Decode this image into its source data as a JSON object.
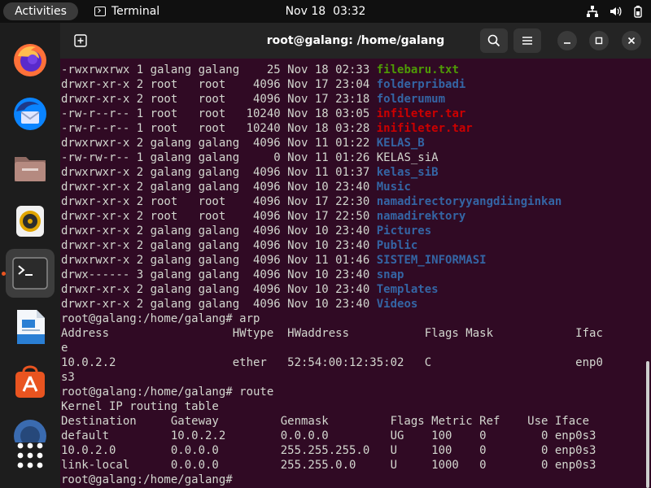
{
  "topbar": {
    "activities": "Activities",
    "app_name": "Terminal",
    "clock_date": "Nov 18",
    "clock_time": "03:32",
    "tray_icons": [
      "network-icon",
      "volume-icon",
      "battery-icon"
    ]
  },
  "dock": {
    "items": [
      {
        "name": "firefox",
        "icon": "firefox-icon",
        "running": false
      },
      {
        "name": "thunderbird",
        "icon": "thunderbird-icon",
        "running": false
      },
      {
        "name": "files",
        "icon": "folder-icon",
        "running": false
      },
      {
        "name": "rhythmbox",
        "icon": "speaker-icon",
        "running": false
      },
      {
        "name": "terminal",
        "icon": "terminal-icon",
        "running": true
      },
      {
        "name": "libreoffice-writer",
        "icon": "writer-icon",
        "running": false
      },
      {
        "name": "app-center",
        "icon": "store-icon",
        "running": false
      },
      {
        "name": "help",
        "icon": "help-icon",
        "running": false
      },
      {
        "name": "show-apps",
        "icon": "apps-grid-icon",
        "running": false
      }
    ]
  },
  "window": {
    "title": "root@galang: /home/galang",
    "buttons": [
      "new-tab-icon",
      "search-icon",
      "menu-icon",
      "minimize-icon",
      "maximize-icon",
      "close-icon"
    ]
  },
  "colors": {
    "terminal_bg": "#300a24",
    "text": "#d3d7cf",
    "executable": "#4e9a06",
    "directory": "#3465a4",
    "archive": "#cc0000",
    "accent": "#e95420"
  },
  "terminal": {
    "lines": [
      {
        "text": "-rwxrwxrwx 1 galang galang    25 Nov 18 02:33 ",
        "name": "filebaru.txt",
        "kind": "exec"
      },
      {
        "text": "drwxr-xr-x 2 root   root    4096 Nov 17 23:04 ",
        "name": "folderpribadi",
        "kind": "dir"
      },
      {
        "text": "drwxr-xr-x 2 root   root    4096 Nov 17 23:18 ",
        "name": "folderumum",
        "kind": "dir"
      },
      {
        "text": "-rw-r--r-- 1 root   root   10240 Nov 18 03:05 ",
        "name": "infileter.tar",
        "kind": "arch"
      },
      {
        "text": "-rw-r--r-- 1 root   root   10240 Nov 18 03:28 ",
        "name": "inifileter.tar",
        "kind": "arch"
      },
      {
        "text": "drwxrwxr-x 2 galang galang  4096 Nov 11 01:22 ",
        "name": "KELAS_B",
        "kind": "dir"
      },
      {
        "text": "-rw-rw-r-- 1 galang galang     0 Nov 11 01:26 ",
        "name": "KELAS_siA",
        "kind": "plain"
      },
      {
        "text": "drwxrwxr-x 2 galang galang  4096 Nov 11 01:37 ",
        "name": "kelas_siB",
        "kind": "dir"
      },
      {
        "text": "drwxr-xr-x 2 galang galang  4096 Nov 10 23:40 ",
        "name": "Music",
        "kind": "dir"
      },
      {
        "text": "drwxr-xr-x 2 root   root    4096 Nov 17 22:30 ",
        "name": "namadirectoryyangdiinginkan",
        "kind": "dir"
      },
      {
        "text": "drwxr-xr-x 2 root   root    4096 Nov 17 22:50 ",
        "name": "namadirektory",
        "kind": "dir"
      },
      {
        "text": "drwxr-xr-x 2 galang galang  4096 Nov 10 23:40 ",
        "name": "Pictures",
        "kind": "dir"
      },
      {
        "text": "drwxr-xr-x 2 galang galang  4096 Nov 10 23:40 ",
        "name": "Public",
        "kind": "dir"
      },
      {
        "text": "drwxrwxr-x 2 galang galang  4096 Nov 11 01:46 ",
        "name": "SISTEM_INFORMASI",
        "kind": "dir"
      },
      {
        "text": "drwx------ 3 galang galang  4096 Nov 10 23:40 ",
        "name": "snap",
        "kind": "dir"
      },
      {
        "text": "drwxr-xr-x 2 galang galang  4096 Nov 10 23:40 ",
        "name": "Templates",
        "kind": "dir"
      },
      {
        "text": "drwxr-xr-x 2 galang galang  4096 Nov 10 23:40 ",
        "name": "Videos",
        "kind": "dir"
      },
      {
        "text": "root@galang:/home/galang# arp",
        "kind": "line"
      },
      {
        "text": "Address                  HWtype  HWaddress           Flags Mask            Ifac",
        "kind": "line"
      },
      {
        "text": "e",
        "kind": "line"
      },
      {
        "text": "10.0.2.2                 ether   52:54:00:12:35:02   C                     enp0",
        "kind": "line"
      },
      {
        "text": "s3",
        "kind": "line"
      },
      {
        "text": "root@galang:/home/galang# route",
        "kind": "line"
      },
      {
        "text": "Kernel IP routing table",
        "kind": "line"
      },
      {
        "text": "Destination     Gateway         Genmask         Flags Metric Ref    Use Iface",
        "kind": "line"
      },
      {
        "text": "default         10.0.2.2        0.0.0.0         UG    100    0        0 enp0s3",
        "kind": "line"
      },
      {
        "text": "10.0.2.0        0.0.0.0         255.255.255.0   U     100    0        0 enp0s3",
        "kind": "line"
      },
      {
        "text": "link-local      0.0.0.0         255.255.0.0     U     1000   0        0 enp0s3",
        "kind": "line"
      },
      {
        "text": "root@galang:/home/galang# ",
        "kind": "line"
      }
    ]
  }
}
